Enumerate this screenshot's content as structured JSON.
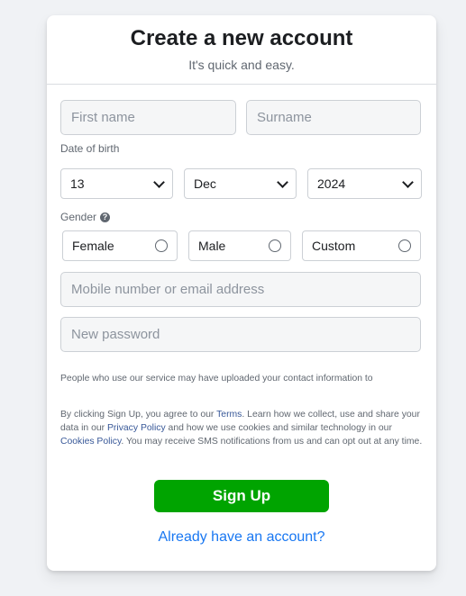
{
  "header": {
    "title": "Create a new account",
    "subtitle": "It's quick and easy."
  },
  "form": {
    "first_name_placeholder": "First name",
    "surname_placeholder": "Surname",
    "dob_label": "Date of birth",
    "dob_day": "13",
    "dob_month": "Dec",
    "dob_year": "2024",
    "gender_label": "Gender",
    "gender_options": [
      "Female",
      "Male",
      "Custom"
    ],
    "mobile_placeholder": "Mobile number or email address",
    "password_placeholder": "New password"
  },
  "legal": {
    "info_text": "People who use our service may have uploaded your contact information to",
    "p1": "By clicking Sign Up, you agree to our ",
    "terms_link": "Terms",
    "p2": ". Learn how we collect, use and share your data in our ",
    "privacy_link": "Privacy Policy",
    "p3": " and how we use cookies and similar technology in our ",
    "cookies_link": "Cookies Policy",
    "p4": ". You may receive SMS notifications from us and can opt out at any time."
  },
  "actions": {
    "signup_label": "Sign Up",
    "already_label": "Already have an account?"
  },
  "colors": {
    "signup": "#00a400",
    "link": "#1877f2",
    "background": "#f0f2f5"
  }
}
